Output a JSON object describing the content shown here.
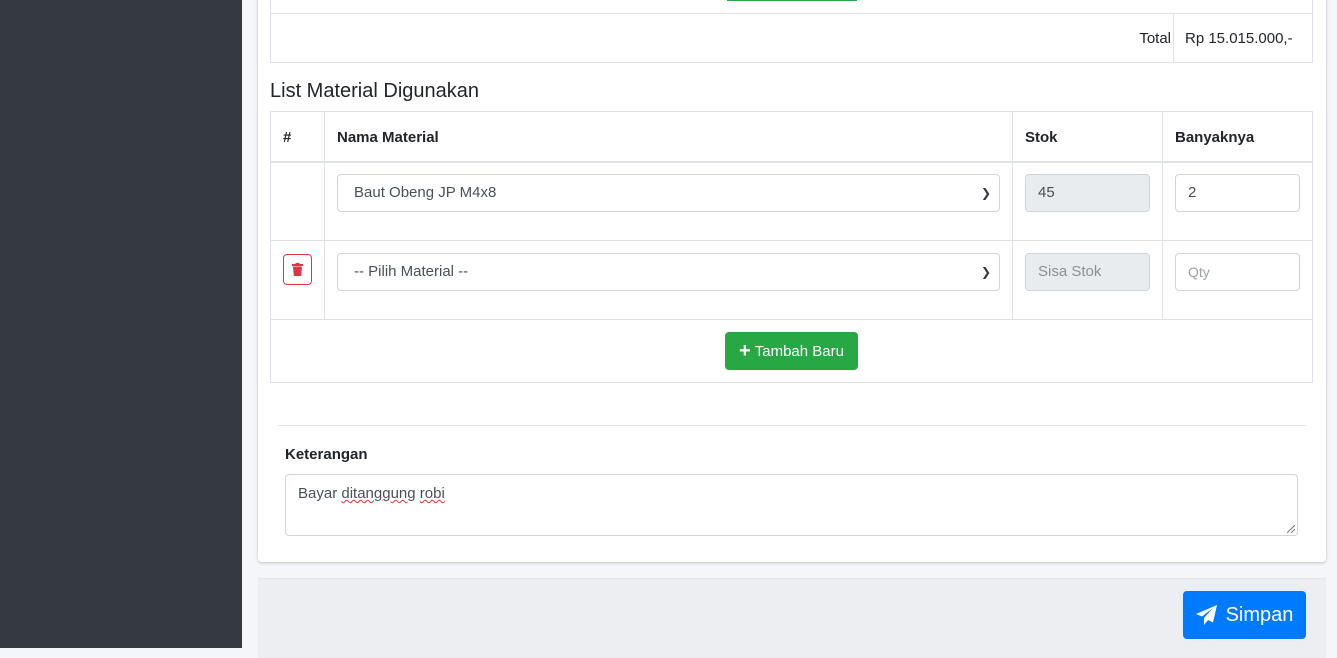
{
  "summary": {
    "total_label": "Total",
    "total_value": "Rp 15.015.000,-"
  },
  "materials": {
    "title": "List Material Digunakan",
    "columns": [
      "#",
      "Nama Material",
      "Stok",
      "Banyaknya"
    ],
    "rows": [
      {
        "material": "Baut Obeng JP M4x8",
        "stock": "45",
        "qty": "2"
      },
      {
        "material_placeholder": "-- Pilih Material --",
        "stock_placeholder": "Sisa Stok",
        "qty_placeholder": "Qty"
      }
    ],
    "add_label": "Tambah Baru"
  },
  "notes": {
    "label": "Keterangan",
    "value_word1": "Bayar",
    "value_word2": "ditanggung",
    "value_word3": "robi"
  },
  "footer": {
    "save_label": "Simpan"
  },
  "colors": {
    "sidebar": "#343a40",
    "success": "#28a745",
    "primary": "#007bff",
    "danger": "#dc3545"
  }
}
